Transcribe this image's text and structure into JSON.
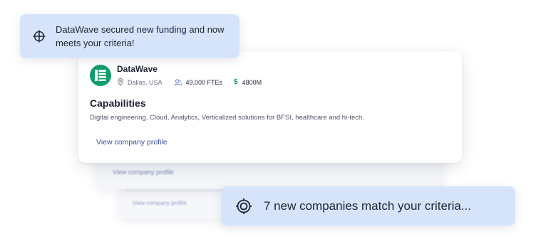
{
  "top_toast": {
    "text": "DataWave secured new funding and now meets your criteria!",
    "icon": "crosshair-icon"
  },
  "company": {
    "name": "DataWave",
    "location": "Dallas, USA",
    "employees": "49,000 FTEs",
    "revenue": "4800M",
    "logo_color": "#0f9d6a"
  },
  "capabilities": {
    "title": "Capabilities",
    "description": "Digital engineering, Cloud, Analytics, Verticalized solutions for BFSI, healthcare and hi-tech."
  },
  "profile_link": "View company profile",
  "background_cards": [
    {
      "link": "View company profile"
    },
    {
      "link": "View company profile"
    }
  ],
  "bottom_toast": {
    "text": "7 new companies match your criteria...",
    "icon": "target-icon"
  }
}
